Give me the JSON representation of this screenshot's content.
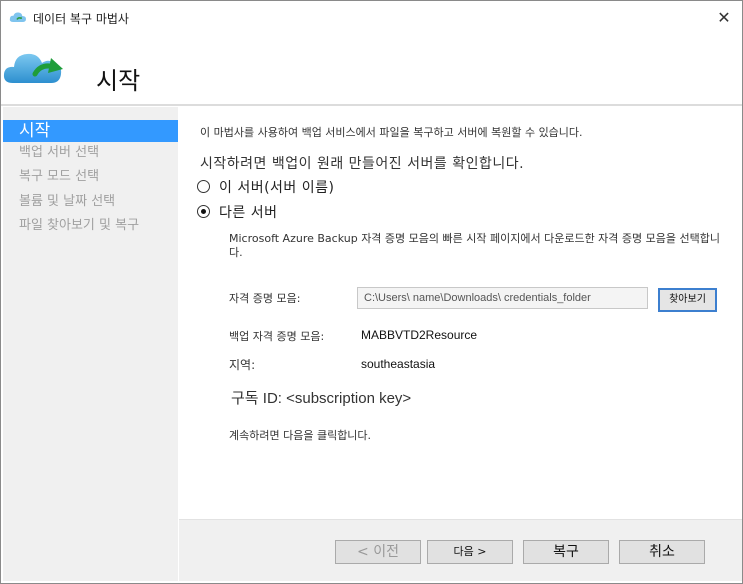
{
  "window": {
    "title": "데이터 복구 마법사",
    "close_glyph": "✕"
  },
  "header": {
    "heading": "시작"
  },
  "nav": {
    "items": [
      {
        "label": "시작",
        "active": true
      },
      {
        "label": "백업 서버 선택",
        "active": false
      },
      {
        "label": "복구 모드 선택",
        "active": false
      },
      {
        "label": "볼륨 및 날짜 선택",
        "active": false
      },
      {
        "label": "파일 찾아보기 및 복구",
        "active": false
      }
    ]
  },
  "main": {
    "intro": "이 마법사를 사용하여 백업 서비스에서 파일을 복구하고 서버에 복원할 수 있습니다.",
    "confirm_prompt": "시작하려면 백업이 원래 만들어진 서버를 확인합니다.",
    "options": [
      {
        "label": "이 서버(서버 이름)",
        "checked": false
      },
      {
        "label": "다른 서버",
        "checked": true
      }
    ],
    "description": "Microsoft Azure Backup 자격 증명 모음의 빠른 시작 페이지에서 다운로드한 자격 증명 모음을 선택합니다.",
    "credentials": {
      "label": "자격 증명 모음:",
      "value": "C:\\Users\\ name\\Downloads\\ credentials_folder",
      "browse_label": "찾아보기"
    },
    "backup_vault": {
      "label": "백업 자격 증명 모음:",
      "value": "MABBVTD2Resource"
    },
    "region": {
      "label": "지역:",
      "value": "southeastasia"
    },
    "subscription": {
      "label_ko": "구독",
      "label_rest": " ID: <subscription key>"
    },
    "continue_text": "계속하려면 다음을 클릭합니다."
  },
  "footer": {
    "prev_label": "< 이전",
    "next_label": "다음 >",
    "recover_label": "복구",
    "cancel_label": "취소"
  },
  "colors": {
    "nav_active": "#3399ff",
    "nav_bg": "#f0f0f0",
    "browse_border": "#3c7fcf"
  },
  "icons": {
    "app": "cloud-refresh-icon",
    "header": "cloud-arrow-icon",
    "close": "close-icon"
  }
}
